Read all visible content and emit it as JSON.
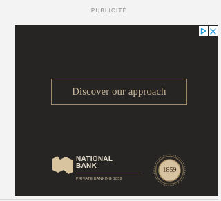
{
  "ad_label": "PUBLICITÉ",
  "ad": {
    "cta_label": "Discover our approach",
    "brand": {
      "name_line1": "NATIONAL",
      "name_line2": "BANK",
      "tagline": "PRIVATE BANKING 1859",
      "seal_text": "1859"
    },
    "adchoices_icons": [
      "adchoices-icon",
      "close-icon"
    ]
  },
  "colors": {
    "page_bg": "#f3f3f3",
    "ad_bg": "#262523",
    "gold": "#c9b79a",
    "border_gold": "#a2896a",
    "adchoices_blue": "#1c9ad6"
  }
}
